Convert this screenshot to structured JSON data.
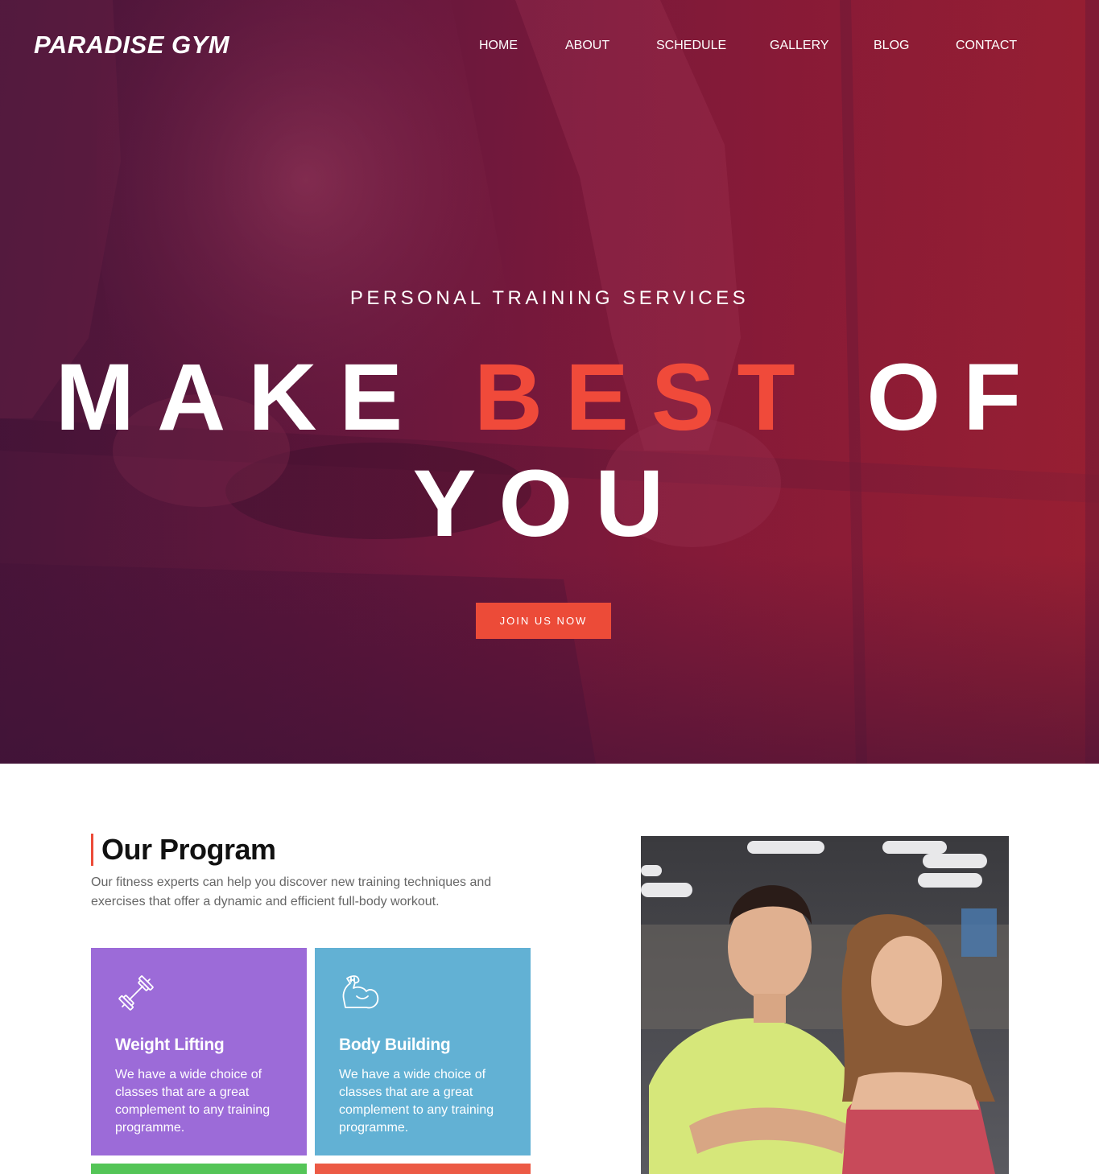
{
  "brand": {
    "logo_text": "PARADISE GYM"
  },
  "nav": {
    "items": [
      {
        "label": "HOME"
      },
      {
        "label": "ABOUT"
      },
      {
        "label": "SCHEDULE"
      },
      {
        "label": "GALLERY"
      },
      {
        "label": "BLOG"
      },
      {
        "label": "CONTACT"
      }
    ]
  },
  "hero": {
    "eyebrow": "PERSONAL TRAINING SERVICES",
    "title_part1": "MAKE ",
    "title_accent": "BEST",
    "title_part2": " OF",
    "title_line2": "YOU",
    "cta_label": "JOIN US NOW"
  },
  "program": {
    "heading": "Our Program",
    "description": "Our fitness experts can help you discover new training techniques and exercises that offer a dynamic and efficient full-body workout.",
    "cards": [
      {
        "title": "Weight Lifting",
        "text": "We have a wide choice of classes that are a great complement to any training programme.",
        "icon": "dumbbell-icon",
        "color": "#9c6bd8"
      },
      {
        "title": "Body Building",
        "text": "We have a wide choice of classes that are a great complement to any training programme.",
        "icon": "flexed-arm-icon",
        "color": "#62b1d4"
      }
    ],
    "strip_colors": [
      "#54c557",
      "#ec5a45"
    ]
  },
  "colors": {
    "accent": "#ec4b38",
    "hero_gradient_start": "#4a1838",
    "hero_gradient_end": "#9a2032"
  }
}
